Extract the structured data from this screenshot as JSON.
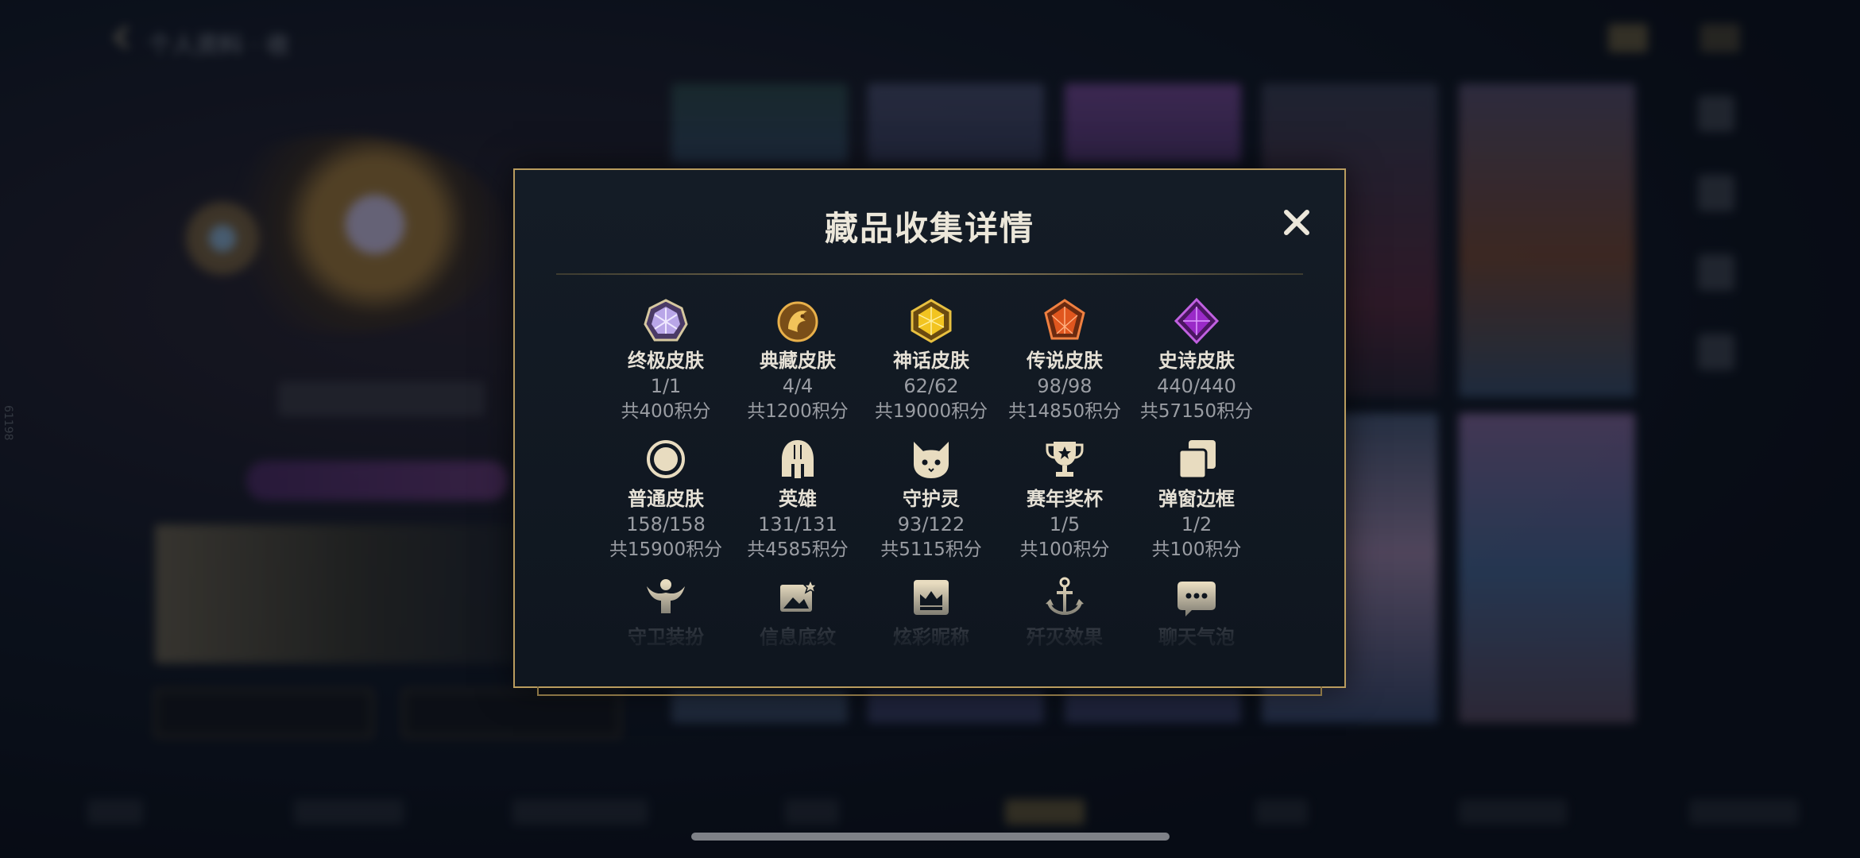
{
  "background": {
    "top_title": "个人资料 · 收",
    "side_text": "61198"
  },
  "modal": {
    "title": "藏品收集详情",
    "close_icon": "close-icon",
    "items": [
      {
        "name": "终极皮肤",
        "count": "1/1",
        "score": "共400积分",
        "icon": "ultimate-skin-icon"
      },
      {
        "name": "典藏皮肤",
        "count": "4/4",
        "score": "共1200积分",
        "icon": "collection-skin-icon"
      },
      {
        "name": "神话皮肤",
        "count": "62/62",
        "score": "共19000积分",
        "icon": "mythic-skin-icon"
      },
      {
        "name": "传说皮肤",
        "count": "98/98",
        "score": "共14850积分",
        "icon": "legendary-skin-icon"
      },
      {
        "name": "史诗皮肤",
        "count": "440/440",
        "score": "共57150积分",
        "icon": "epic-skin-icon"
      },
      {
        "name": "普通皮肤",
        "count": "158/158",
        "score": "共15900积分",
        "icon": "normal-skin-icon"
      },
      {
        "name": "英雄",
        "count": "131/131",
        "score": "共4585积分",
        "icon": "hero-helmet-icon"
      },
      {
        "name": "守护灵",
        "count": "93/122",
        "score": "共5115积分",
        "icon": "guardian-spirit-icon"
      },
      {
        "name": "赛年奖杯",
        "count": "1/5",
        "score": "共100积分",
        "icon": "trophy-icon"
      },
      {
        "name": "弹窗边框",
        "count": "1/2",
        "score": "共100积分",
        "icon": "popup-frame-icon"
      },
      {
        "name": "守卫装扮",
        "icon": "guard-outfit-icon"
      },
      {
        "name": "信息底纹",
        "icon": "info-pattern-icon"
      },
      {
        "name": "炫彩昵称",
        "icon": "colorful-nickname-icon"
      },
      {
        "name": "歼灭效果",
        "icon": "annihilation-effect-icon"
      },
      {
        "name": "聊天气泡",
        "icon": "chat-bubble-icon"
      }
    ]
  },
  "colors": {
    "accent_gold": "#b99c5e",
    "title_text": "#ece7da",
    "sub_text": "#9a9da3"
  }
}
